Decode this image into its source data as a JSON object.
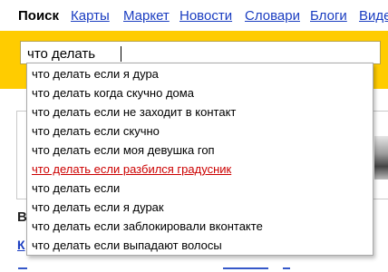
{
  "nav": {
    "active": "Поиск",
    "links": [
      "Карты",
      "Маркет",
      "Новости",
      "Словари",
      "Блоги",
      "Видео"
    ]
  },
  "search": {
    "value": "что делать",
    "placeholder": ""
  },
  "suggestions": [
    "что делать если я дура",
    "что делать когда скучно дома",
    "что делать если не заходит в контакт",
    "что делать если скучно",
    "что делать если моя девушка гоп",
    "что делать если разбился градусник",
    "что делать если",
    "что делать если я дурак",
    "что делать если заблокировали вконтакте",
    "что делать если выпадают волосы"
  ],
  "highlighted_index": 5,
  "background": {
    "letter_b": "В",
    "letter_k": "К"
  },
  "colors": {
    "accent_yellow": "#ffcc00",
    "link_blue": "#1a3dc1",
    "highlight_red": "#cc0000"
  }
}
